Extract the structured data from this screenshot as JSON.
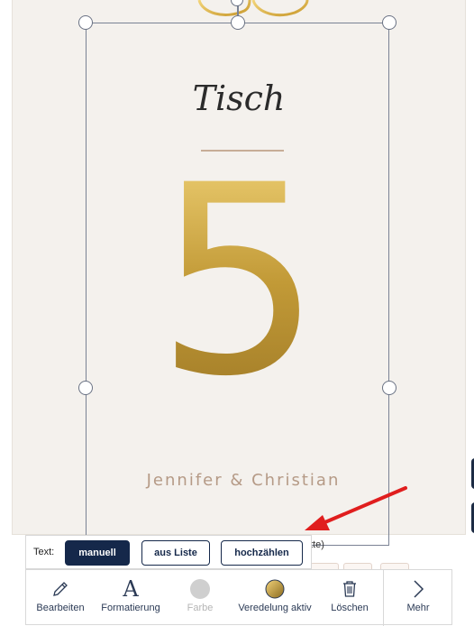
{
  "card": {
    "title_script": "Tisch",
    "number": "5",
    "names": "Jennifer & Christian"
  },
  "behind_text": "tte)",
  "text_popover": {
    "label": "Text:",
    "buttons": [
      {
        "label": "manuell",
        "active": true
      },
      {
        "label": "aus Liste",
        "active": false
      },
      {
        "label": "hochzählen",
        "active": false
      }
    ]
  },
  "toolbar": {
    "items": [
      {
        "label": "Bearbeiten",
        "icon": "pencil-icon"
      },
      {
        "label": "Formatierung",
        "icon": "font-a-icon"
      },
      {
        "label": "Farbe",
        "icon": "color-dot-icon",
        "disabled": true
      },
      {
        "label": "Veredelung aktiv",
        "icon": "gold-foil-icon"
      },
      {
        "label": "Löschen",
        "icon": "trash-icon"
      },
      {
        "label": "Mehr",
        "icon": "chevron-right-icon"
      }
    ]
  },
  "colors": {
    "primary": "#15284a",
    "card_bg": "#f4f1ed",
    "names": "#b59a86",
    "gold": "#c9a23a",
    "annotation": "#e01e1e"
  }
}
